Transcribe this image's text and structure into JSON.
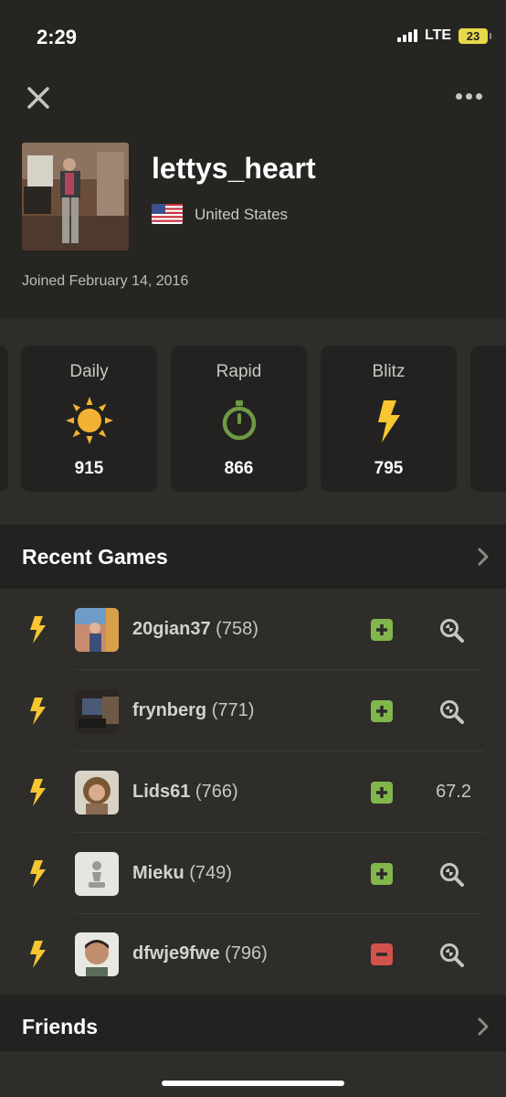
{
  "status_bar": {
    "time": "2:29",
    "network": "LTE",
    "battery": "23"
  },
  "header": {
    "close_icon": "close-icon",
    "more_icon": "more-horizontal-icon",
    "username": "lettys_heart",
    "country": "United States",
    "joined": "Joined February 14, 2016"
  },
  "ratings": [
    {
      "label": "Daily",
      "icon": "sun-icon",
      "value": "915",
      "color": "#f3b233"
    },
    {
      "label": "Rapid",
      "icon": "stopwatch-icon",
      "value": "866",
      "color": "#6e9a45"
    },
    {
      "label": "Blitz",
      "icon": "lightning-icon",
      "value": "795",
      "color": "#f7c631"
    }
  ],
  "recent_games": {
    "title": "Recent Games",
    "games": [
      {
        "name": "20gian37",
        "rating": "(758)",
        "result": "win",
        "action": "analyze"
      },
      {
        "name": "frynberg",
        "rating": "(771)",
        "result": "win",
        "action": "analyze"
      },
      {
        "name": "Lids61",
        "rating": "(766)",
        "result": "win",
        "action": "67.2"
      },
      {
        "name": "Mieku",
        "rating": "(749)",
        "result": "win",
        "action": "analyze"
      },
      {
        "name": "dfwje9fwe",
        "rating": "(796)",
        "result": "loss",
        "action": "analyze"
      }
    ]
  },
  "friends": {
    "title": "Friends"
  },
  "colors": {
    "win": "#81b64c",
    "loss": "#d2524c",
    "bolt": "#f7c631"
  }
}
